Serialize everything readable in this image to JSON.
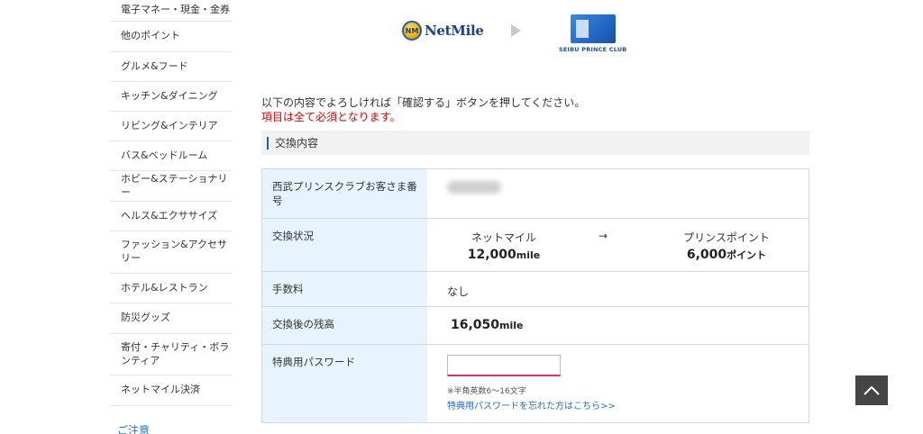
{
  "sidebar": {
    "items": [
      {
        "label": "電子マネー・現金・金券"
      },
      {
        "label": "他のポイント"
      },
      {
        "label": "グルメ&フード"
      },
      {
        "label": "キッチン&ダイニング"
      },
      {
        "label": "リビング&インテリア"
      },
      {
        "label": "バス&ベッドルーム"
      },
      {
        "label": "ホビー&ステーショナリー"
      },
      {
        "label": "ヘルス&エクササイズ"
      },
      {
        "label": "ファッション&アクセサリー"
      },
      {
        "label": "ホテル&レストラン"
      },
      {
        "label": "防災グッズ"
      },
      {
        "label": "寄付・チャリティ・ボランティア"
      },
      {
        "label": "ネットマイル決済"
      }
    ],
    "note_link": "ご注意"
  },
  "logos": {
    "netmile": {
      "mark": "NM",
      "text": "NetMile"
    },
    "partner": {
      "text": "SEIBU PRINCE CLUB"
    }
  },
  "messages": {
    "instruction": "以下の内容でよろしければ「確認する」ボタンを押してください。",
    "required": "項目は全て必須となります。"
  },
  "section": {
    "title": "交換内容"
  },
  "table": {
    "member_number_label": "西武プリンスクラブお客さま番号",
    "exchange_status_label": "交換状況",
    "from_label": "ネットマイル",
    "from_value": "12,000",
    "from_unit": "mile",
    "arrow": "→",
    "to_label": "プリンスポイント",
    "to_value": "6,000",
    "to_unit": "ポイント",
    "fee_label": "手数料",
    "fee_value": "なし",
    "balance_label": "交換後の残高",
    "balance_value": "16,050",
    "balance_unit": "mile",
    "password_label": "特典用パスワード",
    "password_value": "",
    "password_hint": "※半角英数6〜16文字",
    "password_forgot_link": "特典用パスワードを忘れた方はこちら>>"
  },
  "colors": {
    "accent_blue": "#1a5fb4",
    "required_red": "#e00000",
    "label_bg": "#e8f4fd",
    "input_underline": "#e0306a"
  },
  "icons": {
    "arrow": "play-arrow-icon",
    "scroll_top": "chevron-up-icon"
  }
}
